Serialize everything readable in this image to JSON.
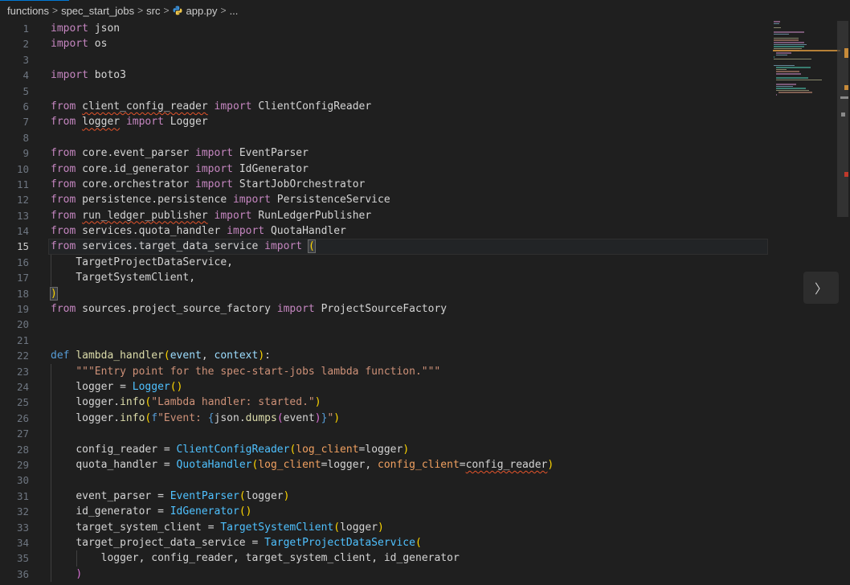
{
  "breadcrumb": {
    "items": [
      "functions",
      "spec_start_jobs",
      "src",
      "app.py",
      "..."
    ],
    "separator": ">"
  },
  "editor": {
    "active_line": 15,
    "colors": {
      "keyword": "#c586c0",
      "def": "#569cd6",
      "function": "#dcdcaa",
      "class": "#4ec9b0",
      "string": "#ce9178",
      "param": "#9cdcfe"
    },
    "lines": [
      {
        "n": "1",
        "t": "import json"
      },
      {
        "n": "2",
        "t": "import os"
      },
      {
        "n": "3",
        "t": ""
      },
      {
        "n": "4",
        "t": "import boto3"
      },
      {
        "n": "5",
        "t": ""
      },
      {
        "n": "6",
        "t": "from client_config_reader import ClientConfigReader"
      },
      {
        "n": "7",
        "t": "from logger import Logger"
      },
      {
        "n": "8",
        "t": ""
      },
      {
        "n": "9",
        "t": "from core.event_parser import EventParser"
      },
      {
        "n": "10",
        "t": "from core.id_generator import IdGenerator"
      },
      {
        "n": "11",
        "t": "from core.orchestrator import StartJobOrchestrator"
      },
      {
        "n": "12",
        "t": "from persistence.persistence import PersistenceService"
      },
      {
        "n": "13",
        "t": "from run_ledger_publisher import RunLedgerPublisher"
      },
      {
        "n": "14",
        "t": "from services.quota_handler import QuotaHandler"
      },
      {
        "n": "15",
        "t": "from services.target_data_service import ("
      },
      {
        "n": "16",
        "t": "    TargetProjectDataService,"
      },
      {
        "n": "17",
        "t": "    TargetSystemClient,"
      },
      {
        "n": "18",
        "t": ")"
      },
      {
        "n": "19",
        "t": "from sources.project_source_factory import ProjectSourceFactory"
      },
      {
        "n": "20",
        "t": ""
      },
      {
        "n": "21",
        "t": ""
      },
      {
        "n": "22",
        "t": "def lambda_handler(event, context):"
      },
      {
        "n": "23",
        "t": "    \"\"\"Entry point for the spec-start-jobs lambda function.\"\"\""
      },
      {
        "n": "24",
        "t": "    logger = Logger()"
      },
      {
        "n": "25",
        "t": "    logger.info(\"Lambda handler: started.\")"
      },
      {
        "n": "26",
        "t": "    logger.info(f\"Event: {json.dumps(event)}\")"
      },
      {
        "n": "27",
        "t": ""
      },
      {
        "n": "28",
        "t": "    config_reader = ClientConfigReader(log_client=logger)"
      },
      {
        "n": "29",
        "t": "    quota_handler = QuotaHandler(log_client=logger, config_client=config_reader)"
      },
      {
        "n": "30",
        "t": ""
      },
      {
        "n": "31",
        "t": "    event_parser = EventParser(logger)"
      },
      {
        "n": "32",
        "t": "    id_generator = IdGenerator()"
      },
      {
        "n": "33",
        "t": "    target_system_client = TargetSystemClient(logger)"
      },
      {
        "n": "34",
        "t": "    target_project_data_service = TargetProjectDataService("
      },
      {
        "n": "35",
        "t": "        logger, config_reader, target_system_client, id_generator"
      },
      {
        "n": "36",
        "t": "    )"
      }
    ]
  },
  "controls": {
    "next_glyph": "〉"
  }
}
